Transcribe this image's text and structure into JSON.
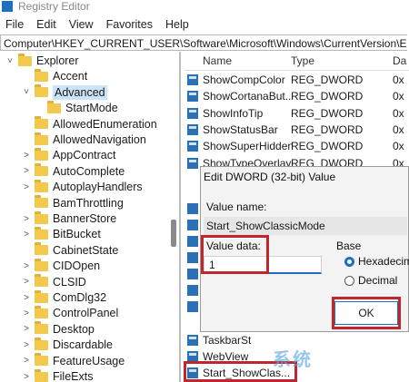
{
  "window": {
    "title": "Registry Editor"
  },
  "menu": [
    "File",
    "Edit",
    "View",
    "Favorites",
    "Help"
  ],
  "address": "Computer\\HKEY_CURRENT_USER\\Software\\Microsoft\\Windows\\CurrentVersion\\Explorer\\Advanced",
  "tree": [
    {
      "label": "Explorer",
      "level": 0,
      "expander": "˅"
    },
    {
      "label": "Accent",
      "level": 1,
      "expander": ""
    },
    {
      "label": "Advanced",
      "level": 1,
      "expander": "˅",
      "selected": true
    },
    {
      "label": "StartMode",
      "level": 2,
      "expander": ""
    },
    {
      "label": "AllowedEnumeration",
      "level": 1,
      "expander": ""
    },
    {
      "label": "AllowedNavigation",
      "level": 1,
      "expander": ""
    },
    {
      "label": "AppContract",
      "level": 1,
      "expander": ">"
    },
    {
      "label": "AutoComplete",
      "level": 1,
      "expander": ">"
    },
    {
      "label": "AutoplayHandlers",
      "level": 1,
      "expander": ">"
    },
    {
      "label": "BamThrottling",
      "level": 1,
      "expander": ""
    },
    {
      "label": "BannerStore",
      "level": 1,
      "expander": ">"
    },
    {
      "label": "BitBucket",
      "level": 1,
      "expander": ">"
    },
    {
      "label": "CabinetState",
      "level": 1,
      "expander": ""
    },
    {
      "label": "CIDOpen",
      "level": 1,
      "expander": ">"
    },
    {
      "label": "CLSID",
      "level": 1,
      "expander": ">"
    },
    {
      "label": "ComDlg32",
      "level": 1,
      "expander": ">"
    },
    {
      "label": "ControlPanel",
      "level": 1,
      "expander": ">"
    },
    {
      "label": "Desktop",
      "level": 1,
      "expander": ">"
    },
    {
      "label": "Discardable",
      "level": 1,
      "expander": ">"
    },
    {
      "label": "FeatureUsage",
      "level": 1,
      "expander": ">"
    },
    {
      "label": "FileExts",
      "level": 1,
      "expander": ">"
    }
  ],
  "list": {
    "columns": [
      "Name",
      "Type",
      "Da"
    ],
    "rows": [
      {
        "name": "ShowCompColor",
        "type": "REG_DWORD",
        "data": "0x"
      },
      {
        "name": "ShowCortanaBut...",
        "type": "REG_DWORD",
        "data": "0x"
      },
      {
        "name": "ShowInfoTip",
        "type": "REG_DWORD",
        "data": "0x"
      },
      {
        "name": "ShowStatusBar",
        "type": "REG_DWORD",
        "data": "0x"
      },
      {
        "name": "ShowSuperHidden",
        "type": "REG_DWORD",
        "data": "0x"
      },
      {
        "name": "ShowTypeOverlay",
        "type": "REG_DWORD",
        "data": "0x"
      }
    ],
    "bottom_rows": [
      {
        "name": "TaskbarSt"
      },
      {
        "name": "WebView"
      },
      {
        "name": "Start_ShowClas..."
      }
    ]
  },
  "dialog": {
    "title": "Edit DWORD (32-bit) Value",
    "value_name_label": "Value name:",
    "value_name": "Start_ShowClassicMode",
    "value_data_label": "Value data:",
    "value_data": "1",
    "base_label": "Base",
    "base_options": [
      "Hexadecimal",
      "Decimal"
    ],
    "base_selected": "Hexadecimal",
    "ok_label": "OK"
  },
  "watermark": "系统"
}
